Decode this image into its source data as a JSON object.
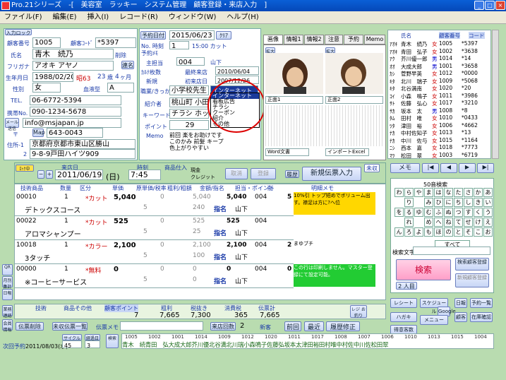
{
  "window": {
    "title": "Pro.21シリーズ　-[　美容室　ラッキー　システム管理　顧客登録・来店入力　]"
  },
  "menu": [
    "ファイル(F)",
    "編集(E)",
    "挿入(I)",
    "レコード(R)",
    "ウィンドウ(W)",
    "ヘルプ(H)"
  ],
  "customer": {
    "entry_label": "入力ロック",
    "no_label": "顧客番号",
    "no": "1005",
    "code_label": "顧客ｺｰﾄﾞ",
    "code": "*5397",
    "name_label": "氏名",
    "name": "青木　続乃",
    "delete_label": "削除",
    "furigana_label": "フリガナ",
    "furigana": "アオキ アヤノ",
    "connect_label": "連名",
    "birth_label": "生年月日",
    "birth": "1988/02/20",
    "era": "昭63",
    "age": "23",
    "age_unit": "歳",
    "month": "4",
    "month_unit": "ヶ月",
    "sex_label": "性別",
    "sex": "女",
    "blood_label": "血液型",
    "blood": "A",
    "tel_label": "TEL.",
    "tel": "06-6772-5394",
    "mobile_label": "携帯No.",
    "mobile": "090-1234-5678",
    "mail_label": "メール送信",
    "mail": "info@msjapan.jp",
    "zip_label": "〒",
    "map_label": "Map",
    "zip": "643-0043",
    "address_label": "住所-1",
    "address1": "京都府京都市東山区勝山",
    "address2_label": "2",
    "address2": "9-8-9戸田ハイツ909"
  },
  "visit": {
    "reserve_label": "予約日付",
    "reserve_date": "2015/06/23",
    "clear": "ｸﾘｱ",
    "no_label": "No. 時刻",
    "no": "1",
    "time": "15:00 カット",
    "memo_label": "予約ﾒﾓ",
    "staff_label": "主担当",
    "staff_no": "004",
    "staff_name": "山下",
    "staff2_label": "ｶﾙﾃ枚数",
    "last_label": "最終来店",
    "last_date": "2010/06/04",
    "new_label": "新規",
    "first_label": "初来店日",
    "first_date": "2007/12/26",
    "job_label": "職業/きっかけ",
    "job": "小学校先生",
    "job2": "インターネット",
    "intro_label": "紹介者",
    "intro": "桃山町 小田",
    "keyword_label": "キーワード",
    "keyword": "チラシ ホット",
    "point_label": "ポイント",
    "point": "29",
    "memo2_label": "Memo",
    "memo_text1": "前回 楽をお助けです",
    "memo_text2": "このかみ 前髪 キープ",
    "memo_text3": "色上がりやすい"
  },
  "dropdown": [
    "インターネット",
    "看板広告",
    "チラシ",
    "クーポン",
    "紹介",
    "その他"
  ],
  "tabs": [
    "画像",
    "情報1",
    "情報2",
    "注意",
    "予約",
    "Memo"
  ],
  "image": {
    "before_label": "拡大",
    "after_label": "拡大",
    "pos1": "正面1",
    "pos2": "正面2",
    "word": "Word文書",
    "excel": "インポートExcel"
  },
  "list": {
    "header_name": "氏名",
    "header_no": "顧客番号",
    "header_code": "コード",
    "items": [
      {
        "kana": "ｱｵｷ",
        "name": "青木　続乃",
        "sex": "女",
        "no": "1005",
        "code": "*5397"
      },
      {
        "kana": "ｱｵｷ",
        "name": "青田　弘子",
        "sex": "女",
        "no": "1002",
        "code": "*3638"
      },
      {
        "kana": "ｱｸ",
        "name": "芥川優一郎",
        "sex": "男",
        "no": "1014",
        "code": "*14"
      },
      {
        "kana": "ｵｵ",
        "name": "大成大郎",
        "sex": "男",
        "no": "1001",
        "code": "*3658"
      },
      {
        "kana": "ｶｼ",
        "name": "菅野早英",
        "sex": "女",
        "no": "1012",
        "code": "*0000"
      },
      {
        "kana": "ｷﾀ",
        "name": "北川　瑞子",
        "sex": "女",
        "no": "1009",
        "code": "*5068"
      },
      {
        "kana": "ｷﾀ",
        "name": "北谷満南",
        "sex": "女",
        "no": "1020",
        "code": "*20"
      },
      {
        "kana": "ｺｲ",
        "name": "小森　鳴子",
        "sex": "女",
        "no": "1011",
        "code": "*3986"
      },
      {
        "kana": "ｻﾄ",
        "name": "佐藤　弘心",
        "sex": "女",
        "no": "1017",
        "code": "*3210"
      },
      {
        "kana": "ｻｶ",
        "name": "坂本　太",
        "sex": "男",
        "no": "1008",
        "code": "*8"
      },
      {
        "kana": "ﾀﾑ",
        "name": "田村　唯",
        "sex": "女",
        "no": "1010",
        "code": "*0433"
      },
      {
        "kana": "ﾂﾀ",
        "name": "津田　裕",
        "sex": "女",
        "no": "1006",
        "code": "*4662"
      },
      {
        "kana": "ﾅｶ",
        "name": "中村佐知子",
        "sex": "女",
        "no": "1013",
        "code": "*13"
      },
      {
        "kana": "ﾅｶ",
        "name": "中川　佐与",
        "sex": "女",
        "no": "1015",
        "code": "*1164"
      },
      {
        "kana": "ﾆｼ",
        "name": "西本　嘉",
        "sex": "女",
        "no": "1018",
        "code": "*7773"
      },
      {
        "kana": "ﾏﾂ",
        "name": "松田　翠",
        "sex": "女",
        "no": "1003",
        "code": "*6719"
      }
    ]
  },
  "slip": {
    "lock": "ﾛｯｸ中",
    "date_label": "来店日",
    "date": "2011/06/19",
    "dow": "(日)",
    "time_label": "時刻",
    "time": "7:45",
    "product_label": "商品仕入",
    "cash": "現金",
    "credit": "クレジット",
    "cancel": "取消",
    "register": "登録",
    "history": "履歴",
    "new_slip": "新規伝票入力",
    "unsettled": "未収"
  },
  "items_header": [
    "技術商品",
    "数量",
    "区分",
    "単価",
    "原単価/税率",
    "粗利/粗額",
    "金額/指名",
    "担当・ポイント",
    "削",
    "明細メモ"
  ],
  "items": [
    {
      "code": "00010",
      "qty": "1",
      "cat": "*カット",
      "price": "5,040",
      "cost": "0",
      "margin": "5,040",
      "amount": "5,040",
      "staff_no": "004",
      "pt": "5",
      "name": "デトックスコース",
      "cost2": "5",
      "margin2": "240",
      "shimei": "指名",
      "staff": "山下",
      "memo": "10%引 トップ短めでボリューム出す。襟足は方に?へ位"
    },
    {
      "code": "00022",
      "qty": "1",
      "cat": "*カット",
      "price": "525",
      "cost": "0",
      "margin": "525",
      "amount": "525",
      "staff_no": "004",
      "pt": "",
      "name": "アロマシャンプー",
      "cost2": "5",
      "margin2": "25",
      "shimei": "指名",
      "staff": "山下",
      "memo": ""
    },
    {
      "code": "10018",
      "qty": "1",
      "cat": "*カラー",
      "price": "2,100",
      "cost": "0",
      "margin": "2,100",
      "amount": "2,100",
      "staff_no": "004",
      "pt": "2",
      "name": "3タッチ",
      "cost2": "5",
      "margin2": "100",
      "shimei": "指名",
      "staff": "山下",
      "memo": "まゆブチ"
    },
    {
      "code": "00000",
      "qty": "1",
      "cat": "*無料",
      "price": "0",
      "cost": "0",
      "margin": "0",
      "amount": "0",
      "staff_no": "004",
      "pt": "0",
      "name": "※コーヒーサービス",
      "cost2": "5",
      "margin2": "0",
      "shimei": "指名",
      "staff": "山下",
      "memo": "この行は印刷しません。マスター登録にて設定可能。"
    }
  ],
  "totals": {
    "tech": "技術",
    "product": "商品その他",
    "point": "顧客ポイント",
    "point_val": "7",
    "margin": "粗利",
    "margin_val": "7,665",
    "tax_excl": "税抜き",
    "tax_excl_val": "7,300",
    "tax": "消費税",
    "tax_val": "365",
    "total": "伝票計",
    "total_val": "7,665",
    "change": "レジ お釣り"
  },
  "bottom": {
    "slip_del": "伝票削除",
    "unsettled_list": "未収伝票一覧",
    "slip_memo": "伝票メモ",
    "visit_count_label": "来店回数",
    "visit_count": "2",
    "new_label": "新客",
    "prev": "前回",
    "latest": "最近",
    "fix": "履歴修正",
    "next_label": "次回予約",
    "next_date": "2011/08/03(水)",
    "cycle": "サイクル",
    "cycle_val": "45",
    "days": "経過日",
    "days_val": "3",
    "search": "検索"
  },
  "kana_label": "50音検索",
  "kana_rows": [
    [
      "わ",
      "ら",
      "や",
      "ま",
      "は",
      "な",
      "た",
      "さ",
      "か",
      "あ"
    ],
    [
      "",
      "り",
      "",
      "み",
      "ひ",
      "に",
      "ち",
      "し",
      "き",
      "い"
    ],
    [
      "を",
      "る",
      "ゆ",
      "む",
      "ふ",
      "ぬ",
      "つ",
      "す",
      "く",
      "う"
    ],
    [
      "",
      "れ",
      "",
      "め",
      "へ",
      "ね",
      "て",
      "せ",
      "け",
      "え"
    ],
    [
      "ん",
      "ろ",
      "よ",
      "も",
      "ほ",
      "の",
      "と",
      "そ",
      "こ",
      "お"
    ]
  ],
  "kana_all": "すべて",
  "search_label": "検索文字",
  "search_btn": "検索",
  "people": "2 人目",
  "name_search": "検索顧客登録",
  "new_search": "新規顧客登録",
  "memo_btn": "メモ",
  "side_btns": [
    "QR",
    "月別集計",
    "日報",
    "業務連絡",
    "会員情報"
  ],
  "tools": [
    "レシート",
    "スケジュール",
    "日報",
    "予約一覧",
    "ハガキ",
    "Google",
    "顧客",
    "在庫確認",
    "メニュー",
    "得意客数"
  ],
  "strip_nums": [
    "1005",
    "1002",
    "1001",
    "1014",
    "1009",
    "1012",
    "1020",
    "1011",
    "1017",
    "1008",
    "1007",
    "1006",
    "1010",
    "1013",
    "1015",
    "1004"
  ],
  "strip_names": "青木　続青田　弘大成大郎芥川優北谷満北川瑞小森鳴子佐藤弘坂本太津田裕田村唯中村佐中川佐松田翠"
}
